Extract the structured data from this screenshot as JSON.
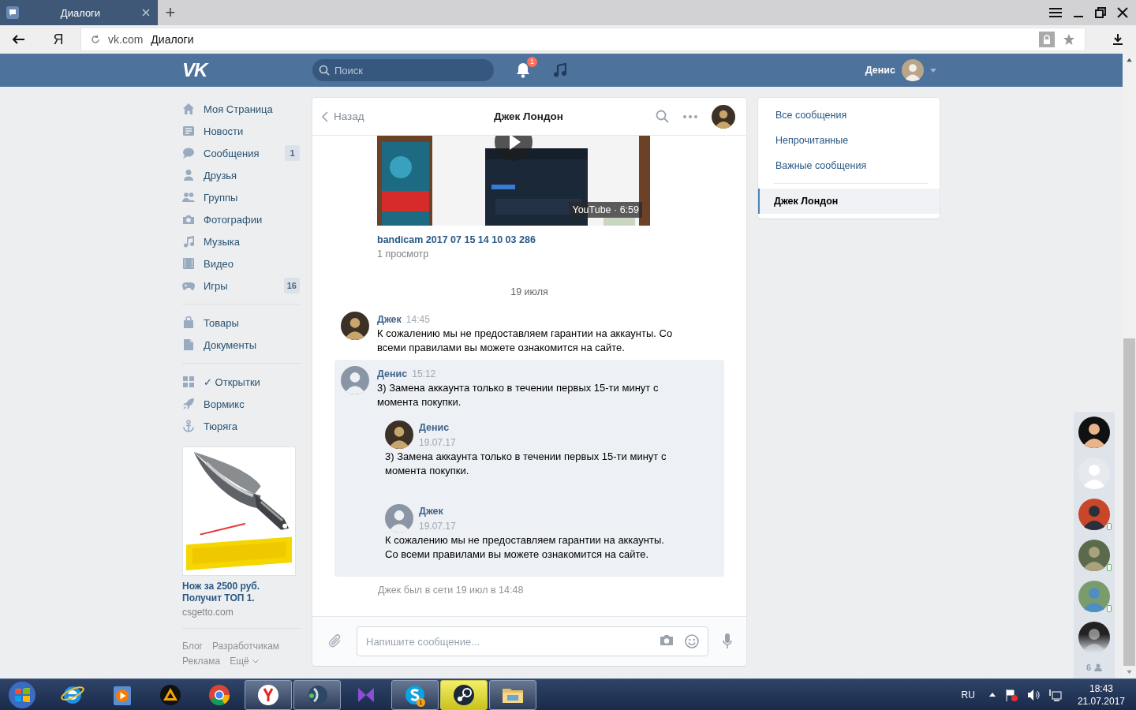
{
  "browser": {
    "tabs": [
      {
        "title": "Диалоги",
        "selected": true
      }
    ],
    "new_tab": "+",
    "home": "Я",
    "address": {
      "domain": "vk.com",
      "title": "Диалоги"
    }
  },
  "header": {
    "logo": "VK",
    "search": {
      "placeholder": "Поиск"
    },
    "notifications": "1",
    "user": "Денис"
  },
  "sidebar": {
    "groups": [
      {
        "items": [
          {
            "label": "Моя Страница"
          },
          {
            "label": "Новости"
          },
          {
            "label": "Сообщения",
            "badge": "1"
          },
          {
            "label": "Друзья"
          },
          {
            "label": "Группы"
          },
          {
            "label": "Фотографии"
          },
          {
            "label": "Музыка"
          },
          {
            "label": "Видео"
          },
          {
            "label": "Игры",
            "badge": "16"
          }
        ]
      },
      {
        "items": [
          {
            "label": "Товары"
          },
          {
            "label": "Документы"
          }
        ]
      },
      {
        "items": [
          {
            "label": "✓ Открытки"
          },
          {
            "label": "Вормикс"
          },
          {
            "label": "Тюряга"
          }
        ]
      }
    ],
    "ad": {
      "title": "Нож за 2500 руб.\nПолучит ТОП 1.",
      "domain": "csgetto.com"
    },
    "footer": {
      "links": [
        "Блог",
        "Разработчикам",
        "Реклама",
        "Ещё"
      ]
    }
  },
  "chat": {
    "back": "Назад",
    "title": "Джек Лондон",
    "video": {
      "source": "YouTube · 6:59",
      "title": "bandicam 2017 07 15 14 10 03 286",
      "views": "1 просмотр"
    },
    "date": "19 июля",
    "messages": [
      {
        "author": "Джек",
        "time": "14:45",
        "text": "К сожалению мы не предоставляем гарантии на аккаунты. Со всеми правилами вы можете ознакомится на сайте.",
        "selected": false
      },
      {
        "author": "Денис",
        "time": "15:12",
        "text": "3) Замена аккаунта только в течении первых 15-ти минут с момента покупки.",
        "selected": true,
        "forwarded": [
          {
            "author": "Денис",
            "date": "19.07.17",
            "text": "3) Замена аккаунта только в течении первых 15-ти минут с момента покупки."
          },
          {
            "author": "Джек",
            "date": "19.07.17",
            "text": "К сожалению мы не предоставляем гарантии на аккаунты. Со всеми правилами вы можете ознакомится на сайте."
          }
        ]
      }
    ],
    "status": "Джек был в сети 19 июл в 14:48",
    "composer": {
      "placeholder": "Напишите сообщение..."
    }
  },
  "folders": {
    "items": [
      {
        "label": "Все сообщения",
        "selected": false
      },
      {
        "label": "Непрочитанные",
        "selected": false
      },
      {
        "label": "Важные сообщения",
        "selected": false
      }
    ],
    "dialogs": [
      {
        "label": "Джек Лондон",
        "selected": true
      }
    ]
  },
  "friends": {
    "avatars": [
      {
        "mobile": false
      },
      {
        "mobile": false
      },
      {
        "mobile": true
      },
      {
        "mobile": true
      },
      {
        "mobile": true
      },
      {
        "mobile": false
      }
    ],
    "count": "6"
  },
  "taskbar": {
    "apps": [
      {
        "kind": "pinned"
      },
      {
        "kind": "pinned"
      },
      {
        "kind": "pinned"
      },
      {
        "kind": "pinned"
      },
      {
        "kind": "running"
      },
      {
        "kind": "running"
      },
      {
        "kind": "pinned"
      },
      {
        "kind": "running",
        "badge": "1"
      },
      {
        "kind": "flashing"
      },
      {
        "kind": "running"
      }
    ],
    "lang": "RU",
    "time": "18:43",
    "date": "21.07.2017"
  }
}
